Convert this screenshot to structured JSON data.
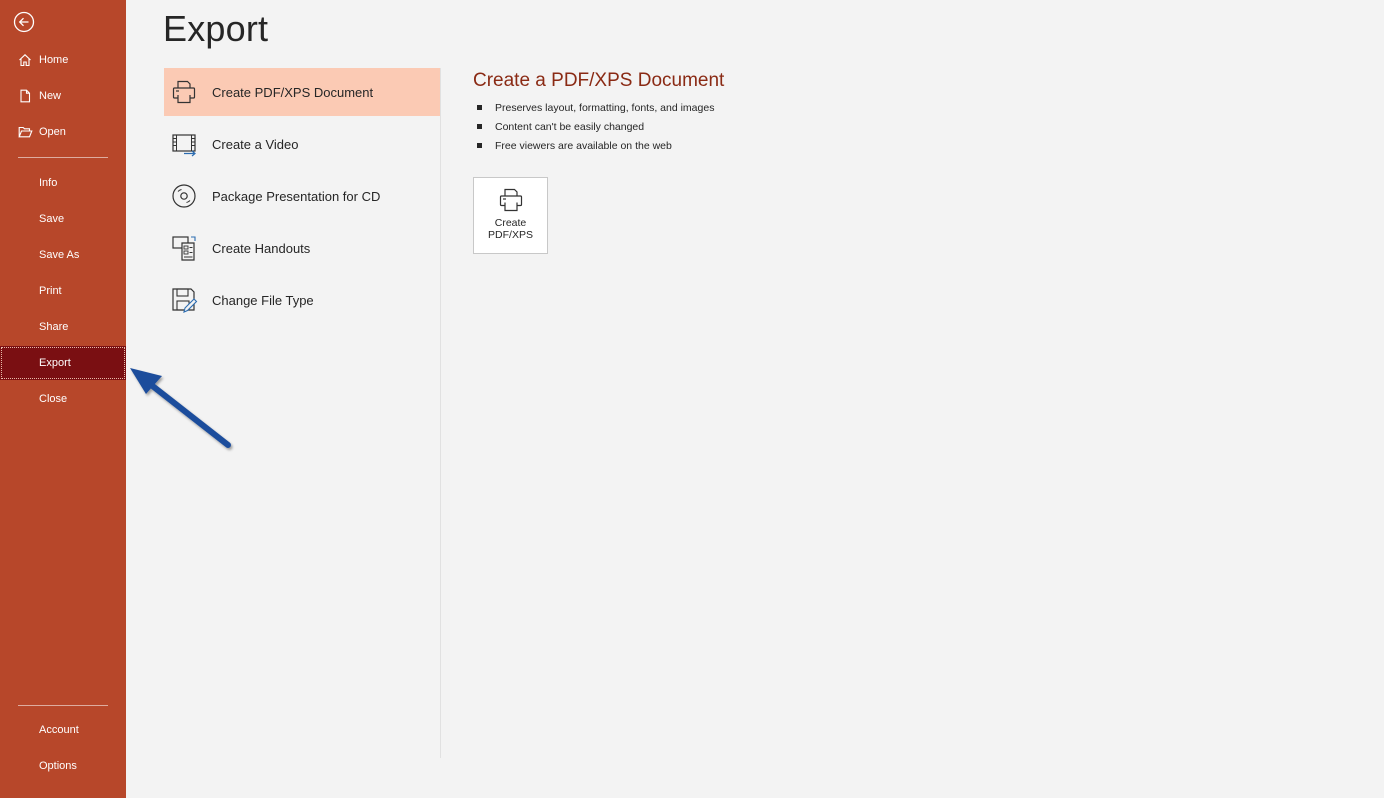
{
  "sidebar": {
    "items": [
      {
        "label": "Home",
        "icon": "home-icon"
      },
      {
        "label": "New",
        "icon": "new-document-icon"
      },
      {
        "label": "Open",
        "icon": "folder-open-icon"
      },
      {
        "label": "Info"
      },
      {
        "label": "Save"
      },
      {
        "label": "Save As"
      },
      {
        "label": "Print"
      },
      {
        "label": "Share"
      },
      {
        "label": "Export",
        "active": true
      },
      {
        "label": "Close"
      }
    ],
    "bottom_items": [
      {
        "label": "Account"
      },
      {
        "label": "Options"
      }
    ]
  },
  "main": {
    "title": "Export",
    "options": [
      {
        "label": "Create PDF/XPS Document",
        "icon": "pdf-printer-icon",
        "selected": true
      },
      {
        "label": "Create a Video",
        "icon": "video-film-icon"
      },
      {
        "label": "Package Presentation for CD",
        "icon": "cd-disc-icon"
      },
      {
        "label": "Create Handouts",
        "icon": "handouts-icon"
      },
      {
        "label": "Change File Type",
        "icon": "change-file-type-icon"
      }
    ],
    "detail": {
      "title": "Create a PDF/XPS Document",
      "bullets": [
        "Preserves layout, formatting, fonts, and images",
        "Content can't be easily changed",
        "Free viewers are available on the web"
      ],
      "button_label": "Create PDF/XPS"
    }
  },
  "colors": {
    "sidebar_bg": "#b7472a",
    "sidebar_active": "#7a0f12",
    "selected_option": "#fbcab4",
    "detail_title": "#8a2a14",
    "annotation_arrow": "#1f4e9c"
  }
}
